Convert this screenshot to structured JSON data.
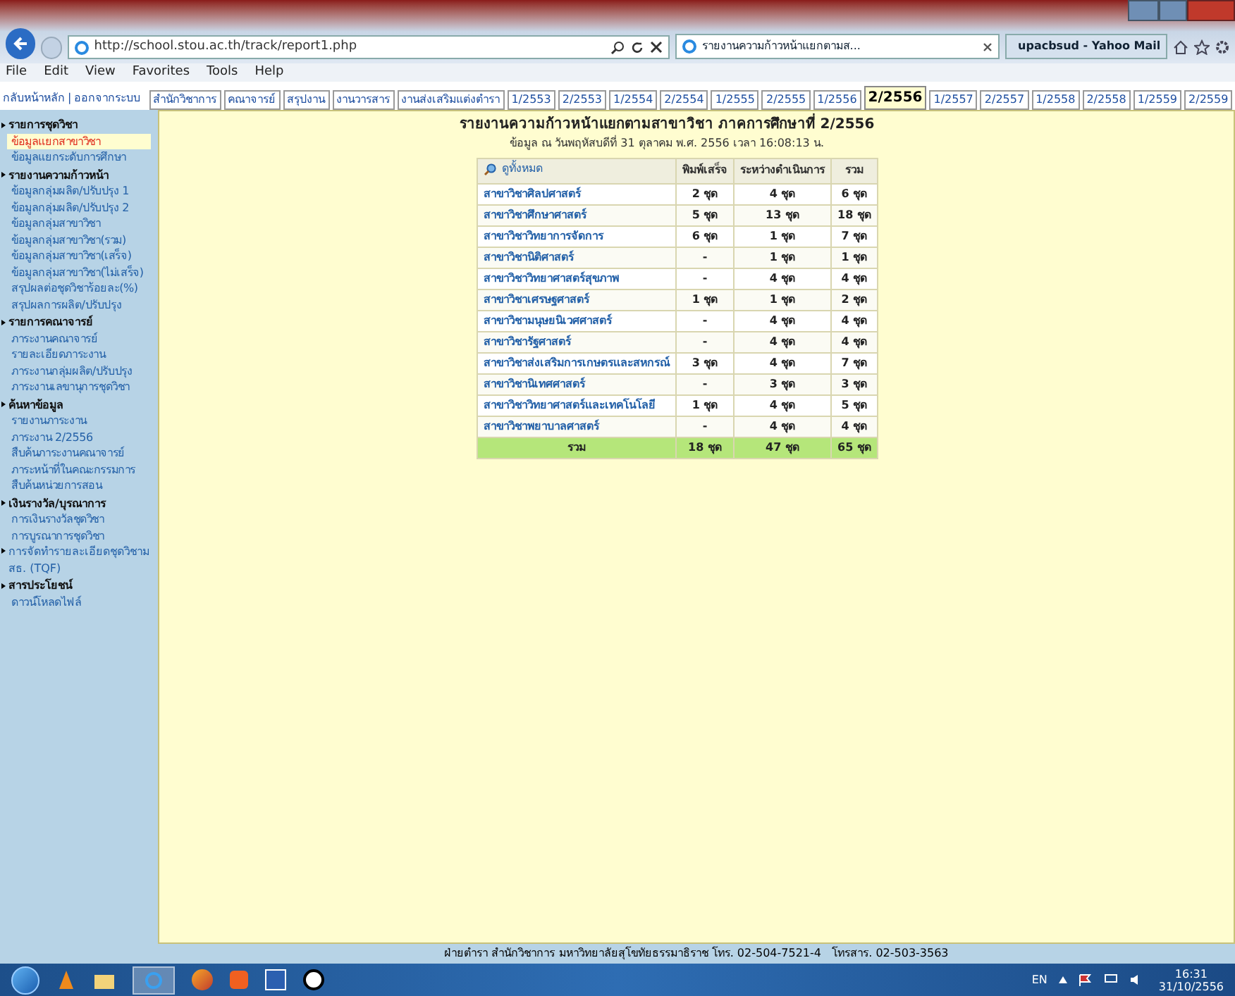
{
  "browser": {
    "address": "http://school.stou.ac.th/track/report1.php",
    "tabs": [
      {
        "label": "รายงานความก้าวหน้าแยกตามส...",
        "selected": true,
        "kind": "page"
      },
      {
        "label": "upacbsud - Yahoo Mail",
        "selected": false,
        "kind": "mail"
      }
    ],
    "menu": [
      "File",
      "Edit",
      "View",
      "Favorites",
      "Tools",
      "Help"
    ]
  },
  "nav": {
    "links": [
      "กลับหน้าหลัก",
      "ออกจากระบบ"
    ],
    "separator": "|",
    "tabs": [
      {
        "label": "สำนักวิชาการ",
        "selected": false
      },
      {
        "label": "คณาจารย์",
        "selected": false
      },
      {
        "label": "สรุปงาน",
        "selected": false
      },
      {
        "label": "งานวารสาร",
        "selected": false
      },
      {
        "label": "งานส่งเสริมแต่งตำรา",
        "selected": false
      },
      {
        "label": "1/2553",
        "selected": false
      },
      {
        "label": "2/2553",
        "selected": false
      },
      {
        "label": "1/2554",
        "selected": false
      },
      {
        "label": "2/2554",
        "selected": false
      },
      {
        "label": "1/2555",
        "selected": false
      },
      {
        "label": "2/2555",
        "selected": false
      },
      {
        "label": "1/2556",
        "selected": false
      },
      {
        "label": "2/2556",
        "selected": true
      },
      {
        "label": "1/2557",
        "selected": false
      },
      {
        "label": "2/2557",
        "selected": false
      },
      {
        "label": "1/2558",
        "selected": false
      },
      {
        "label": "2/2558",
        "selected": false
      },
      {
        "label": "1/2559",
        "selected": false
      },
      {
        "label": "2/2559",
        "selected": false
      }
    ]
  },
  "sidebar": [
    {
      "kind": "section",
      "label": "รายการชุดวิชา"
    },
    {
      "kind": "link",
      "label": "ข้อมูลแยกสาขาวิชา",
      "selected": true
    },
    {
      "kind": "link",
      "label": "ข้อมูลแยกระดับการศึกษา",
      "selected": false
    },
    {
      "kind": "section",
      "label": "รายงานความก้าวหน้า"
    },
    {
      "kind": "link",
      "label": "ข้อมูลกลุ่มผลิต/ปรับปรุง 1",
      "selected": false
    },
    {
      "kind": "link",
      "label": "ข้อมูลกลุ่มผลิต/ปรับปรุง 2",
      "selected": false
    },
    {
      "kind": "link",
      "label": "ข้อมูลกลุ่มสาขาวิชา",
      "selected": false
    },
    {
      "kind": "link",
      "label": "ข้อมูลกลุ่มสาขาวิชา(รวม)",
      "selected": false
    },
    {
      "kind": "link",
      "label": "ข้อมูลกลุ่มสาขาวิชา(เสร็จ)",
      "selected": false
    },
    {
      "kind": "link",
      "label": "ข้อมูลกลุ่มสาขาวิชา(ไม่เสร็จ)",
      "selected": false
    },
    {
      "kind": "link",
      "label": "สรุปผลต่อชุดวิชาร้อยละ(%)",
      "selected": false
    },
    {
      "kind": "link",
      "label": "สรุปผลการผลิต/ปรับปรุง",
      "selected": false
    },
    {
      "kind": "section",
      "label": "รายการคณาจารย์"
    },
    {
      "kind": "link",
      "label": "ภาระงานคณาจารย์",
      "selected": false
    },
    {
      "kind": "link",
      "label": "รายละเอียดภาระงาน",
      "selected": false
    },
    {
      "kind": "link",
      "label": "ภาระงานกลุ่มผลิต/ปรับปรุง",
      "selected": false
    },
    {
      "kind": "link",
      "label": "ภาระงานเลขานุการชุดวิชา",
      "selected": false
    },
    {
      "kind": "section",
      "label": "ค้นหาข้อมูล"
    },
    {
      "kind": "link",
      "label": "รายงานภาระงาน",
      "selected": false
    },
    {
      "kind": "link",
      "label": "ภาระงาน 2/2556",
      "selected": false
    },
    {
      "kind": "link",
      "label": "สืบค้นภาระงานคณาจารย์",
      "selected": false
    },
    {
      "kind": "link",
      "label": "ภาระหน้าที่ในคณะกรรมการ",
      "selected": false
    },
    {
      "kind": "link",
      "label": "สืบค้นหน่วยการสอน",
      "selected": false
    },
    {
      "kind": "section",
      "label": "เงินรางวัล/บุรณาการ"
    },
    {
      "kind": "link",
      "label": "การเงินรางวัลชุดวิชา",
      "selected": false
    },
    {
      "kind": "link",
      "label": "การบูรณาการชุดวิชา",
      "selected": false
    },
    {
      "kind": "bullet",
      "label": "การจัดทำรายละเอียดชุดวิชามสธ. (TQF)"
    },
    {
      "kind": "section",
      "label": "สารประโยชน์"
    },
    {
      "kind": "link",
      "label": "ดาวน์โหลดไฟล์",
      "selected": false
    }
  ],
  "report": {
    "title": "รายงานความก้าวหน้าแยกตามสาขาวิชา ภาคการศึกษาที่ 2/2556",
    "subtitle": "ข้อมูล ณ วันพฤหัสบดีที่ 31 ตุลาคม พ.ศ. 2556 เวลา 16:08:13 น.",
    "columns": [
      "ดูทั้งหมด",
      "พิมพ์เสร็จ",
      "ระหว่างดำเนินการ",
      "รวม"
    ],
    "rows": [
      [
        "สาขาวิชาศิลปศาสตร์",
        "2 ชุด",
        "4 ชุด",
        "6 ชุด"
      ],
      [
        "สาขาวิชาศึกษาศาสตร์",
        "5 ชุด",
        "13 ชุด",
        "18 ชุด"
      ],
      [
        "สาขาวิชาวิทยาการจัดการ",
        "6 ชุด",
        "1 ชุด",
        "7 ชุด"
      ],
      [
        "สาขาวิชานิติศาสตร์",
        "-",
        "1 ชุด",
        "1 ชุด"
      ],
      [
        "สาขาวิชาวิทยาศาสตร์สุขภาพ",
        "-",
        "4 ชุด",
        "4 ชุด"
      ],
      [
        "สาขาวิชาเศรษฐศาสตร์",
        "1 ชุด",
        "1 ชุด",
        "2 ชุด"
      ],
      [
        "สาขาวิชามนุษยนิเวศศาสตร์",
        "-",
        "4 ชุด",
        "4 ชุด"
      ],
      [
        "สาขาวิชารัฐศาสตร์",
        "-",
        "4 ชุด",
        "4 ชุด"
      ],
      [
        "สาขาวิชาส่งเสริมการเกษตรและสหกรณ์",
        "3 ชุด",
        "4 ชุด",
        "7 ชุด"
      ],
      [
        "สาขาวิชานิเทศศาสตร์",
        "-",
        "3 ชุด",
        "3 ชุด"
      ],
      [
        "สาขาวิชาวิทยาศาสตร์และเทคโนโลยี",
        "1 ชุด",
        "4 ชุด",
        "5 ชุด"
      ],
      [
        "สาขาวิชาพยาบาลศาสตร์",
        "-",
        "4 ชุด",
        "4 ชุด"
      ]
    ],
    "total": [
      "รวม",
      "18 ชุด",
      "47 ชุด",
      "65 ชุด"
    ]
  },
  "footer": "ฝ่ายตำรา สำนักวิชาการ มหาวิทยาลัยสุโขทัยธรรมาธิราช โทร. 02-504-7521-4   โทรสาร. 02-503-3563",
  "taskbar": {
    "language": "EN",
    "time": "16:31",
    "date": "31/10/2556"
  }
}
